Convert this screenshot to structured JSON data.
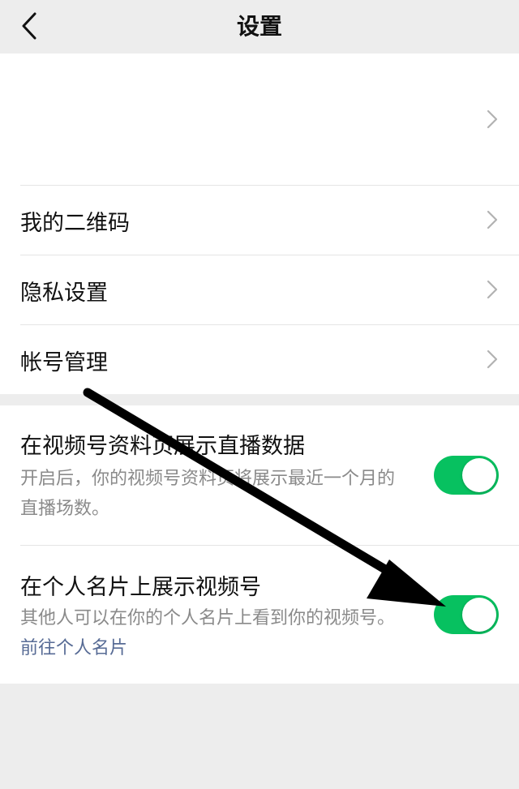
{
  "navbar": {
    "title": "设置",
    "back_icon": "chevron-left-icon"
  },
  "settings": {
    "profile_row": {
      "label": ""
    },
    "items": [
      {
        "label": "我的二维码"
      },
      {
        "label": "隐私设置"
      },
      {
        "label": "帐号管理"
      }
    ]
  },
  "toggles": [
    {
      "title": "在视频号资料页展示直播数据",
      "description": "开启后，你的视频号资料页将展示最近一个月的直播场数。",
      "enabled": true
    },
    {
      "title": "在个人名片上展示视频号",
      "description": "其他人可以在你的个人名片上看到你的视频号。",
      "link": "前往个人名片",
      "enabled": true
    }
  ],
  "colors": {
    "accent_green": "#07c160",
    "link_blue": "#576b95",
    "background": "#ededed"
  }
}
